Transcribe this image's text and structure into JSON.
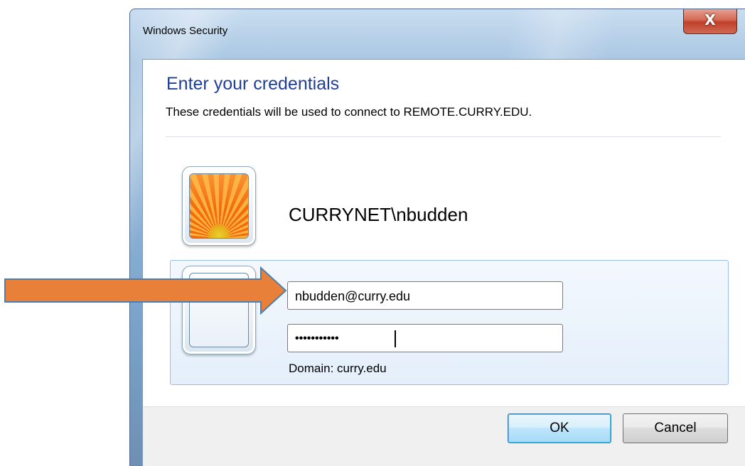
{
  "window": {
    "title": "Windows Security",
    "close_label": "X"
  },
  "dialog": {
    "heading": "Enter your credentials",
    "subtext": "These credentials will be used to connect to REMOTE.CURRY.EDU.",
    "saved_user": "CURRYNET\\nbudden",
    "username_value": "nbudden@curry.edu",
    "password_value": "•••••••••••",
    "domain_text": "Domain: curry.edu"
  },
  "buttons": {
    "ok_label": "OK",
    "cancel_label": "Cancel"
  },
  "annotation": {
    "arrow_color": "#e8803a",
    "arrow_outline": "#4a7fb0"
  },
  "icons": {
    "close": "close-icon",
    "user_picture": "flower-user-picture-icon",
    "blank_user": "blank-user-tile-icon"
  }
}
